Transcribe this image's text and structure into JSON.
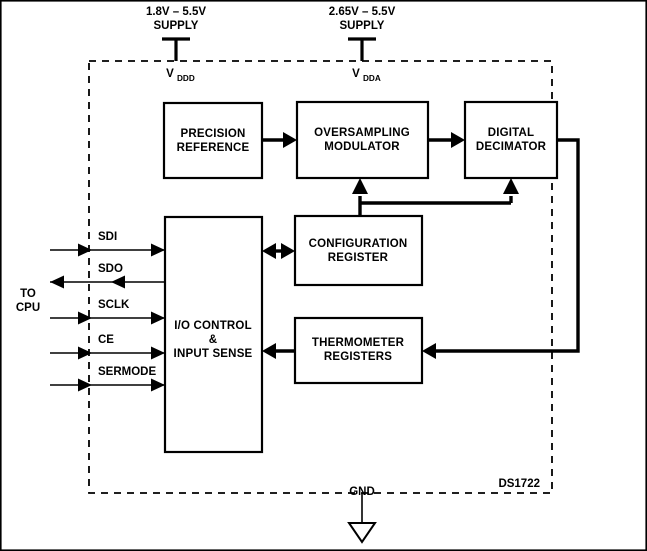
{
  "diagram": {
    "title": "DS1722 Block Diagram",
    "part_number": "DS1722",
    "ink_color": "#000000",
    "background_color": "#ffffff"
  },
  "supplies": [
    {
      "id": "vddd",
      "range_label": "1.8V – 5.5V",
      "supply_label": "SUPPLY",
      "pin_name": "V",
      "pin_subscript": "DDD"
    },
    {
      "id": "vdda",
      "range_label": "2.65V – 5.5V",
      "supply_label": "SUPPLY",
      "pin_name": "V",
      "pin_subscript": "DDA"
    }
  ],
  "ground": {
    "label": "GND",
    "symbol": "ground-triangle"
  },
  "cpu": {
    "line1": "TO",
    "line2": "CPU"
  },
  "signals": [
    {
      "name": "SDI",
      "direction": "input"
    },
    {
      "name": "SDO",
      "direction": "output"
    },
    {
      "name": "SCLK",
      "direction": "input"
    },
    {
      "name": "CE",
      "direction": "input"
    },
    {
      "name": "SERMODE",
      "direction": "input"
    }
  ],
  "blocks": [
    {
      "id": "precision-reference",
      "line1": "PRECISION",
      "line2": "REFERENCE"
    },
    {
      "id": "oversampling-modulator",
      "line1": "OVERSAMPLING",
      "line2": "MODULATOR"
    },
    {
      "id": "digital-decimator",
      "line1": "DIGITAL",
      "line2": "DECIMATOR"
    },
    {
      "id": "io-control",
      "line1": "I/O CONTROL",
      "line2": "&",
      "line3": "INPUT SENSE"
    },
    {
      "id": "configuration-register",
      "line1": "CONFIGURATION",
      "line2": "REGISTER"
    },
    {
      "id": "thermometer-registers",
      "line1": "THERMOMETER",
      "line2": "REGISTERS"
    }
  ],
  "connections": [
    {
      "from": "precision-reference",
      "to": "oversampling-modulator",
      "type": "arrow"
    },
    {
      "from": "oversampling-modulator",
      "to": "digital-decimator",
      "type": "arrow"
    },
    {
      "from": "configuration-register",
      "to": "oversampling-modulator",
      "type": "arrow"
    },
    {
      "from": "configuration-register",
      "to": "digital-decimator",
      "type": "arrow"
    },
    {
      "from": "io-control",
      "to": "configuration-register",
      "type": "bidirectional"
    },
    {
      "from": "thermometer-registers",
      "to": "io-control",
      "type": "arrow"
    },
    {
      "from": "digital-decimator",
      "to": "thermometer-registers",
      "type": "arrow"
    }
  ]
}
